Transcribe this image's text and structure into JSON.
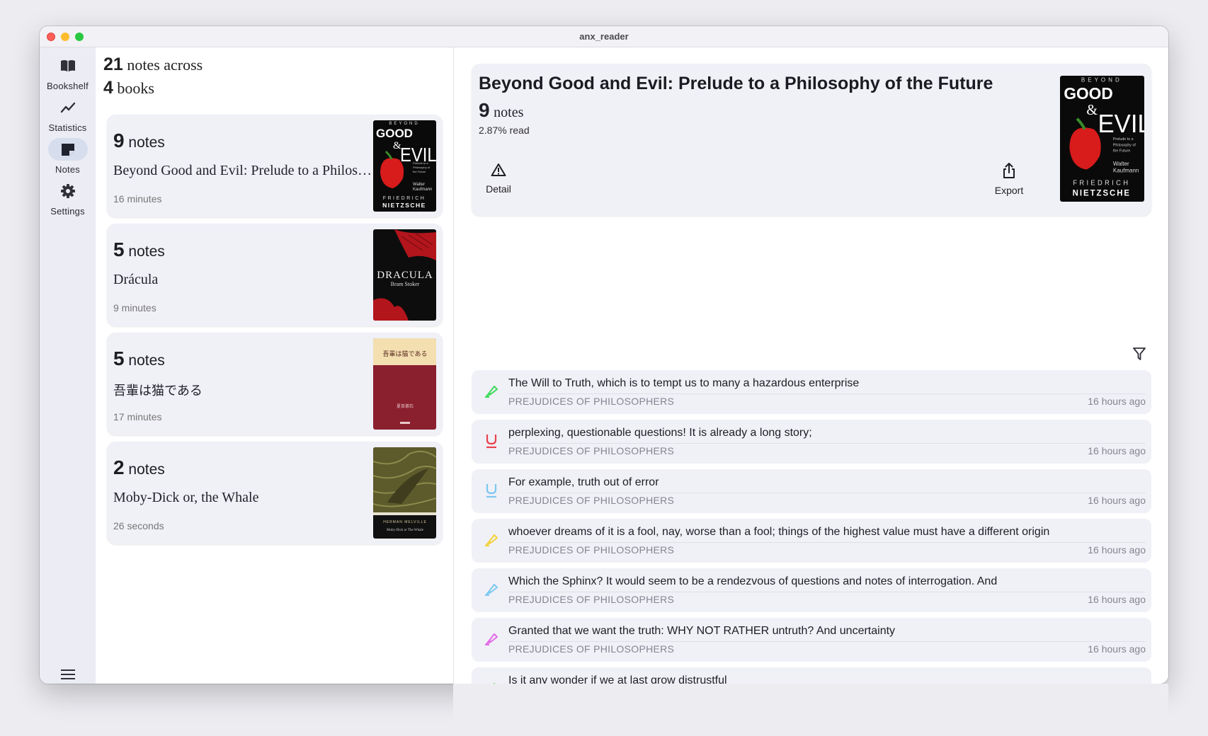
{
  "window": {
    "title": "anx_reader"
  },
  "nav": {
    "items": [
      {
        "label": "Bookshelf",
        "icon": "book-open-icon",
        "active": false
      },
      {
        "label": "Statistics",
        "icon": "chart-line-icon",
        "active": false
      },
      {
        "label": "Notes",
        "icon": "note-icon",
        "active": true
      },
      {
        "label": "Settings",
        "icon": "gear-icon",
        "active": false
      }
    ],
    "menu_icon": "hamburger-menu-icon"
  },
  "summary": {
    "notes_count": "21",
    "notes_text": "notes across",
    "books_count": "4",
    "books_text": "books"
  },
  "books": [
    {
      "count": "9",
      "count_label": "notes",
      "title": "Beyond Good and Evil: Prelude to a Philosophy of the Future",
      "time": "16 minutes",
      "cover": {
        "title_top": "BEYOND",
        "title_main": "GOOD & EVIL",
        "author_first": "FRIEDRICH",
        "author_last": "NIETZSCHE",
        "subtitle": "Prelude to a Philosophy of the Future",
        "translator": "Walter Kaufmann"
      }
    },
    {
      "count": "5",
      "count_label": "notes",
      "title": "Drácula",
      "time": "9 minutes",
      "cover": {
        "title_main": "DRACULA",
        "author": "Bram Stoker"
      }
    },
    {
      "count": "5",
      "count_label": "notes",
      "title": "吾輩は猫である",
      "time": "17 minutes",
      "cover": {
        "title_main": "吾輩は猫である",
        "author": "夏目漱石"
      }
    },
    {
      "count": "2",
      "count_label": "notes",
      "title": "Moby-Dick or, the Whale",
      "time": "26 seconds",
      "cover": {
        "author": "HERMAN MELVILLE",
        "title_main": "Moby-Dick or The Whale"
      }
    }
  ],
  "detail": {
    "title": "Beyond Good and Evil: Prelude to a Philosophy of the Future",
    "count": "9",
    "count_label": "notes",
    "read": "2.87% read",
    "detail_label": "Detail",
    "export_label": "Export"
  },
  "notes": [
    {
      "text": "The Will to Truth, which is to tempt us to many a hazardous enterprise",
      "chapter": "PREJUDICES OF PHILOSOPHERS",
      "time": "16 hours ago",
      "type": "highlight",
      "color": "#3ddc5a"
    },
    {
      "text": "perplexing, questionable questions! It is already a long story;",
      "chapter": "PREJUDICES OF PHILOSOPHERS",
      "time": "16 hours ago",
      "type": "underline",
      "color": "#e8434b"
    },
    {
      "text": "For example, truth out of error",
      "chapter": "PREJUDICES OF PHILOSOPHERS",
      "time": "16 hours ago",
      "type": "underline",
      "color": "#7cc8f0"
    },
    {
      "text": "whoever dreams of it is a fool, nay, worse than a fool; things of the highest value must have a different origin",
      "chapter": "PREJUDICES OF PHILOSOPHERS",
      "time": "16 hours ago",
      "type": "highlight",
      "color": "#f3d23a"
    },
    {
      "text": "Which the Sphinx? It would seem to be a rendezvous of questions and notes of interrogation. And",
      "chapter": "PREJUDICES OF PHILOSOPHERS",
      "time": "16 hours ago",
      "type": "highlight",
      "color": "#7cc8f0"
    },
    {
      "text": "Granted that we want the truth: WHY NOT RATHER untruth? And uncertainty",
      "chapter": "PREJUDICES OF PHILOSOPHERS",
      "time": "16 hours ago",
      "type": "highlight",
      "color": "#e36ae8"
    },
    {
      "text": "Is it any wonder if we at last grow distrustful",
      "chapter": "",
      "time": "",
      "type": "highlight",
      "color": "#3ddc5a"
    }
  ]
}
